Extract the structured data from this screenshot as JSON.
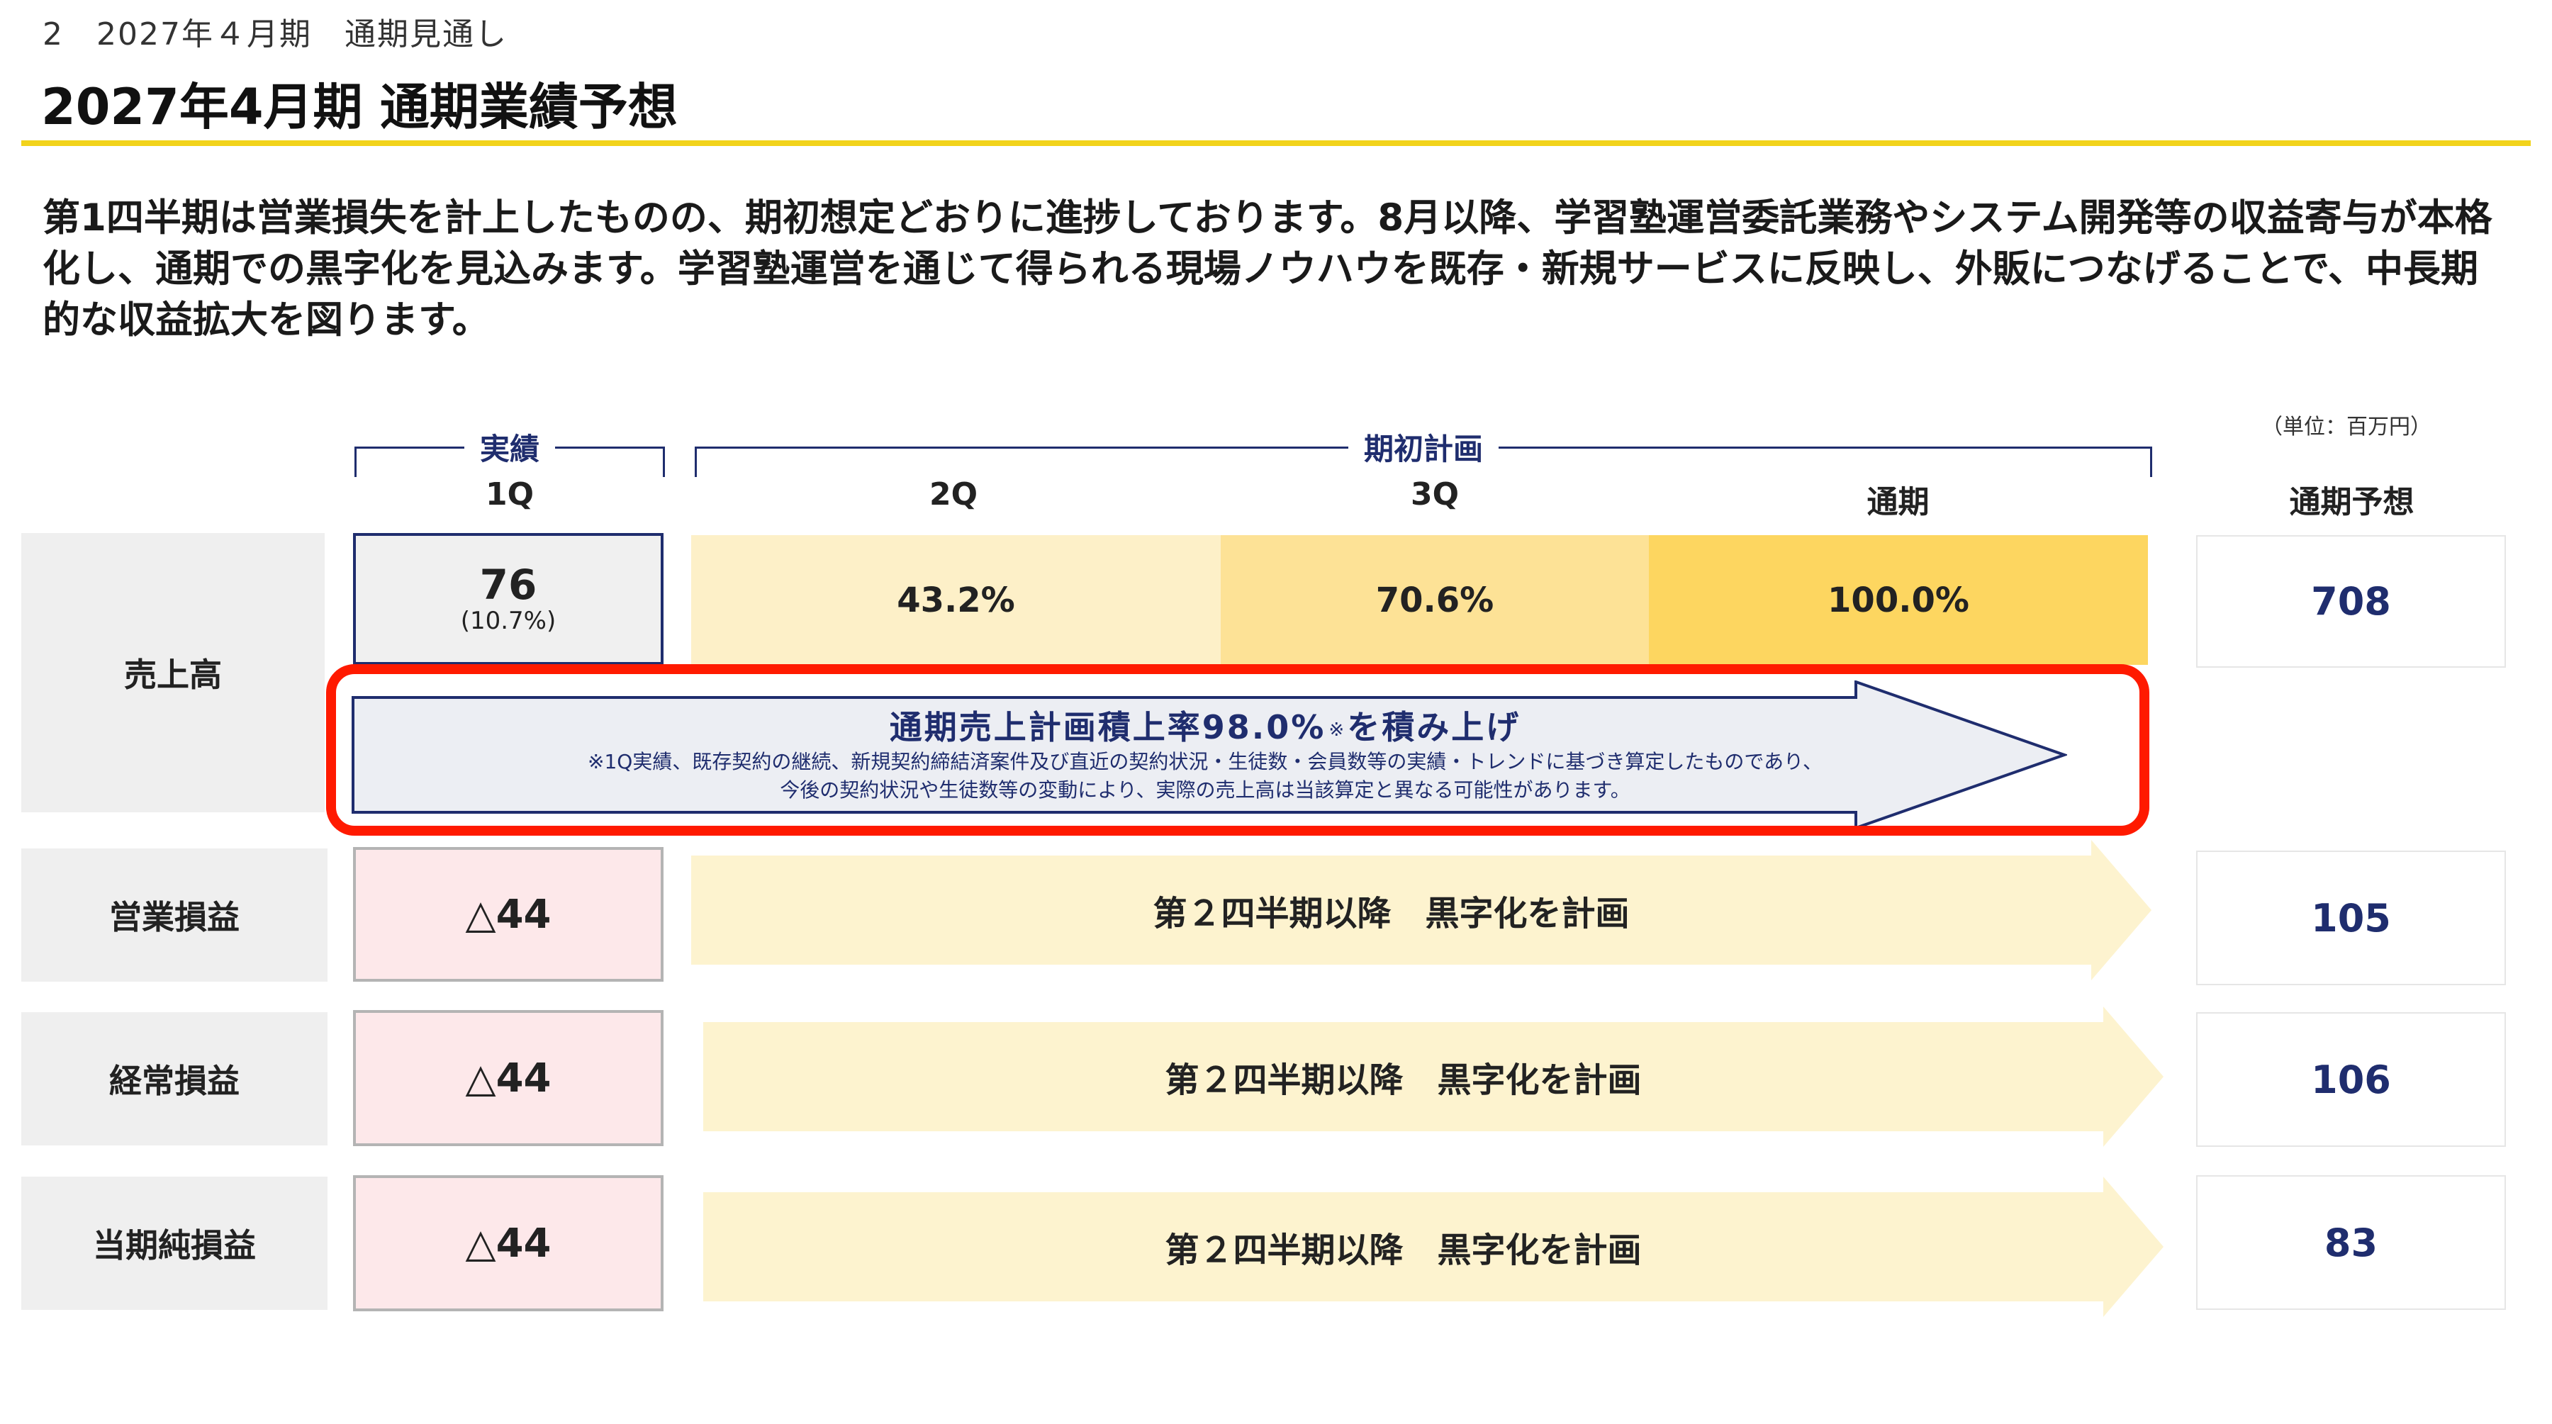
{
  "header": {
    "breadcrumb": "2　2027年４月期　通期見通し",
    "title": "2027年4月期 通期業績予想"
  },
  "intro": {
    "text": "第1四半期は営業損失を計上したものの、期初想定どおりに進捗しております。8月以降、学習塾運営委託業務やシステム開発等の収益寄与が本格化し、通期での黒字化を見込みます。学習塾運営を通じて得られる現場ノウハウを既存・新規サービスに反映し、外販につなげることで、中長期的な収益拡大を図ります。"
  },
  "table": {
    "unit_note": "（単位：百万円）",
    "actual_group_label": "実績",
    "plan_group_label": "期初計画",
    "columns": {
      "q1": "1Q",
      "q2": "2Q",
      "q3": "3Q",
      "full_year": "通期",
      "forecast": "通期予想"
    },
    "rows": {
      "sales": {
        "label": "売上高",
        "q1_value": "76",
        "q1_percent": "(10.7%)",
        "q2_progress": "43.2%",
        "q3_progress": "70.6%",
        "full_progress": "100.0%",
        "forecast": "708"
      },
      "operating": {
        "label": "営業損益",
        "q1_value": "△44",
        "plan_text": "第２四半期以降　黒字化を計画",
        "forecast": "105"
      },
      "ordinary": {
        "label": "経常損益",
        "q1_value": "△44",
        "plan_text": "第２四半期以降　黒字化を計画",
        "forecast": "106"
      },
      "net": {
        "label": "当期純損益",
        "q1_value": "△44",
        "plan_text": "第２四半期以降　黒字化を計画",
        "forecast": "83"
      }
    },
    "callout": {
      "main": "通期売上計画積上率98.0%",
      "mark": "※",
      "suffix": "を積み上げ",
      "note_line1": "※1Q実績、既存契約の継続、新規契約締結済案件及び直近の契約状況・生徒数・会員数等の実績・トレンドに基づき算定したものであり、",
      "note_line2": "今後の契約状況や生徒数等の変動により、実際の売上高は当該算定と異なる可能性があります。"
    }
  },
  "colors": {
    "accent_yellow": "#f2d31b",
    "navy": "#1f2d6e",
    "highlight_red": "#ff1a00",
    "q2_fill": "#fdf0c8",
    "q3_fill": "#fde296",
    "full_fill": "#fdd660",
    "loss_fill": "#fde8ea",
    "band_fill": "#fdf3cf"
  }
}
